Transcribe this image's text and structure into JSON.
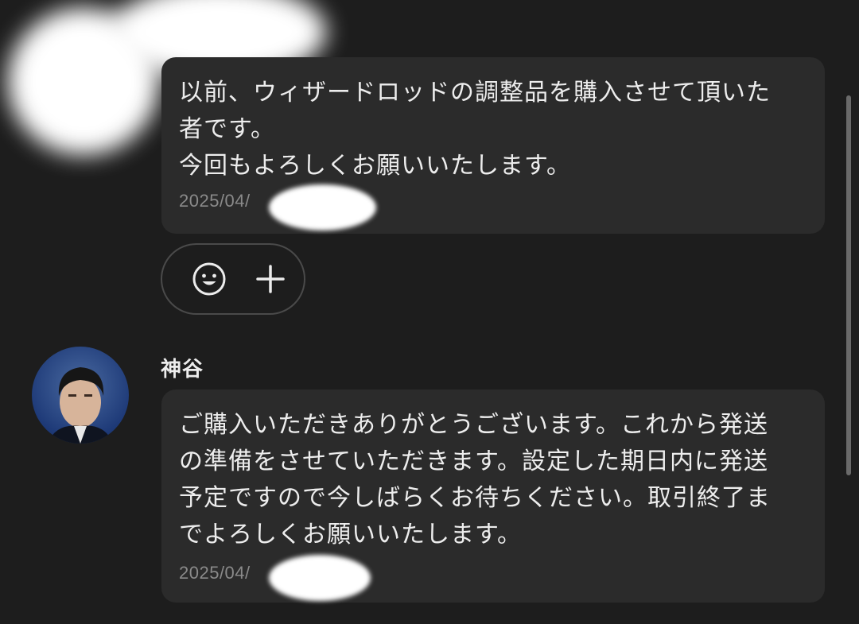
{
  "messages": [
    {
      "text": "以前、ウィザードロッドの調整品を購入させて頂いた\n者です。\n今回もよろしくお願いいたします。",
      "timestamp": "2025/04/"
    },
    {
      "sender": "神谷",
      "text": "ご購入いただきありがとうございます。これから発送\nの準備をさせていただきます。設定した期日内に発送\n予定ですので今しばらくお待ちください。取引終了ま\nでよろしくお願いいたします。",
      "timestamp": "2025/04/"
    }
  ],
  "reactions": {
    "emoji_icon": "smiley-icon",
    "add_icon": "plus-icon"
  },
  "colors": {
    "background": "#1d1d1d",
    "bubble": "#2b2b2b",
    "text": "#ededed",
    "timestamp": "#8a8a8a",
    "redaction": "#ffffff"
  }
}
